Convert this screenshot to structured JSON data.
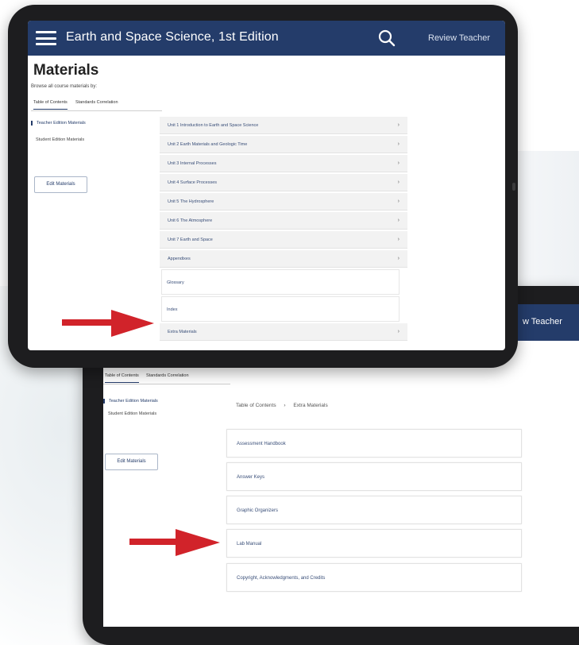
{
  "app": {
    "title": "Earth and Space Science, 1st Edition",
    "user": "Review Teacher",
    "user_partial": "w Teacher"
  },
  "page": {
    "title": "Materials",
    "browse_label": "Browse all course materials by:"
  },
  "tabs": [
    "Table of Contents",
    "Standards Correlation"
  ],
  "sidebar": {
    "items": [
      "Teacher Edition Materials",
      "Student Edition Materials"
    ],
    "edit_button": "Edit Materials"
  },
  "toc": {
    "units": [
      "Unit 1 Introduction to Earth and Space Science",
      "Unit 2 Earth Materials and Geologic Time",
      "Unit 3 Internal Processes",
      "Unit 4 Surface Processes",
      "Unit 5 The Hydrosphere",
      "Unit 6 The Atmosphere",
      "Unit 7 Earth and Space",
      "Appendixes"
    ],
    "plain_items": [
      "Glossary",
      "Index"
    ],
    "extra": "Extra Materials",
    "chevron": "›"
  },
  "breadcrumb": {
    "root": "Table of Contents",
    "separator": "›",
    "current": "Extra Materials"
  },
  "extra_materials": [
    "Assessment Handbook",
    "Answer Keys",
    "Graphic Organizers",
    "Lab Manual",
    "Copyright, Acknowledgments, and Credits"
  ],
  "colors": {
    "header": "#243c6a",
    "arrow": "#d1232a",
    "bezel": "#1d1d1f"
  }
}
